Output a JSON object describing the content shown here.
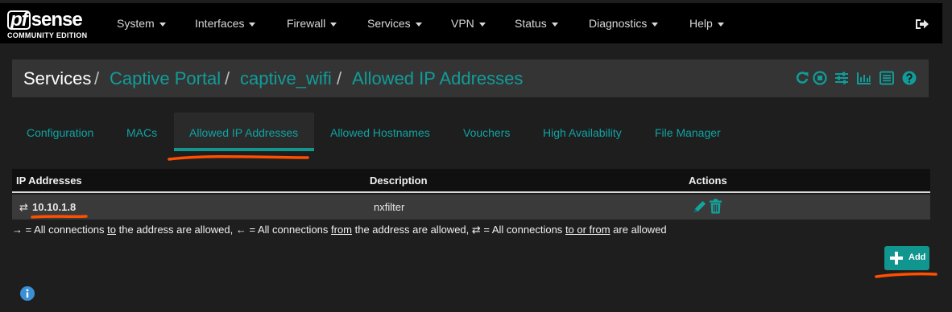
{
  "brand": {
    "logo_main": "sense",
    "logo_pf": "pf",
    "logo_sub": "COMMUNITY EDITION"
  },
  "nav": {
    "items": [
      {
        "label": "System"
      },
      {
        "label": "Interfaces"
      },
      {
        "label": "Firewall"
      },
      {
        "label": "Services"
      },
      {
        "label": "VPN"
      },
      {
        "label": "Status"
      },
      {
        "label": "Diagnostics"
      },
      {
        "label": "Help"
      }
    ]
  },
  "breadcrumb": {
    "root": "Services",
    "sep": "/",
    "links": [
      "Captive Portal",
      "captive_wifi",
      "Allowed IP Addresses"
    ]
  },
  "tabs": [
    {
      "label": "Configuration"
    },
    {
      "label": "MACs"
    },
    {
      "label": "Allowed IP Addresses",
      "active": true
    },
    {
      "label": "Allowed Hostnames"
    },
    {
      "label": "Vouchers"
    },
    {
      "label": "High Availability"
    },
    {
      "label": "File Manager"
    }
  ],
  "table": {
    "headers": [
      "IP Addresses",
      "Description",
      "Actions"
    ],
    "rows": [
      {
        "direction_glyph": "⇄",
        "ip": "10.10.1.8",
        "description": "nxfilter"
      }
    ]
  },
  "legend": {
    "p1": "→ = All connections ",
    "to": "to",
    "p2": " the address are allowed, ← = All connections ",
    "from": "from",
    "p3": " the address are allowed, ⇄ = All connections ",
    "to_or_from": "to or from",
    "p4": " are allowed"
  },
  "add_button": {
    "label": "Add"
  },
  "colors": {
    "accent": "#109d99",
    "annotation": "#ff4f00"
  }
}
